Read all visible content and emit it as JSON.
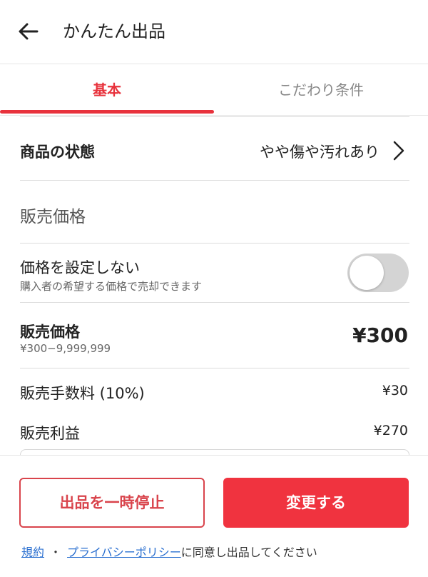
{
  "header": {
    "title": "かんたん出品"
  },
  "tabs": [
    {
      "label": "基本"
    },
    {
      "label": "こだわり条件"
    }
  ],
  "condition": {
    "label": "商品の状態",
    "value": "やや傷や汚れあり"
  },
  "section": {
    "title": "販売価格"
  },
  "no_price": {
    "label": "価格を設定しない",
    "description": "購入者の希望する価格で売却できます",
    "toggle_on": false
  },
  "price": {
    "label": "販売価格",
    "range": "¥300−9,999,999",
    "value": "¥300"
  },
  "fee": {
    "label": "販売手数料 (10%)",
    "value": "¥30"
  },
  "profit": {
    "label": "販売利益",
    "value": "¥270"
  },
  "footer": {
    "stop_label": "出品を一時停止",
    "change_label": "変更する",
    "terms_link": "規約",
    "separator": "・",
    "privacy_link": "プライバシーポリシー",
    "agree_text": "に同意し出品してください"
  },
  "colors": {
    "accent": "#e8323c",
    "button_primary": "#f0333f",
    "link": "#2a6fd0",
    "toggle_off": "#d4d4d4"
  }
}
